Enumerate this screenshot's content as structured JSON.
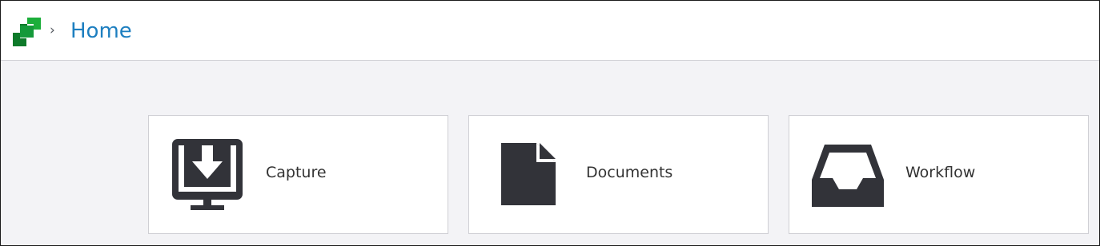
{
  "header": {
    "logo": "app-logo-icon",
    "breadcrumb_separator": "›",
    "breadcrumb_home": "Home"
  },
  "tiles": [
    {
      "label": "Capture",
      "icon": "capture-monitor-download-icon"
    },
    {
      "label": "Documents",
      "icon": "document-icon"
    },
    {
      "label": "Workflow",
      "icon": "inbox-tray-icon"
    }
  ],
  "colors": {
    "logo_green": "#1cae3a",
    "logo_dark_green": "#0e7a2a",
    "link_blue": "#1e7fc0",
    "icon_dark": "#323339",
    "background": "#f3f3f6"
  }
}
